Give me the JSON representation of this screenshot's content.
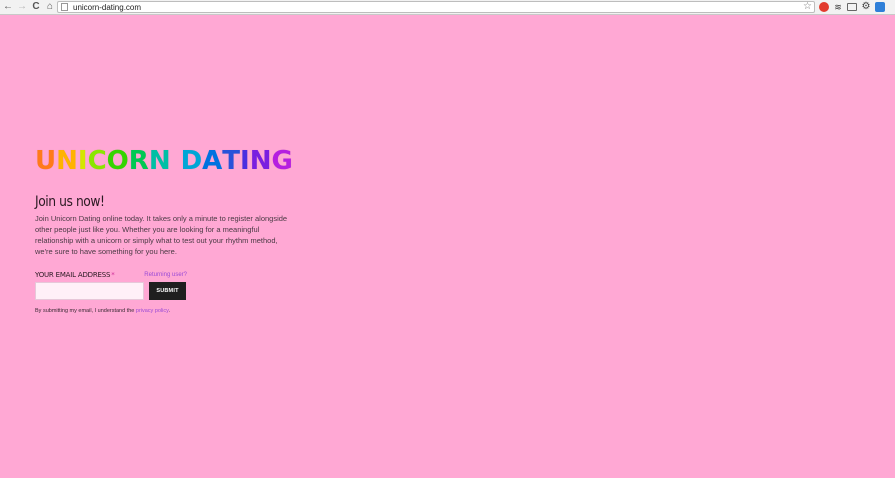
{
  "browser": {
    "url": "unicorn-dating.com",
    "back_glyph": "←",
    "forward_glyph": "→",
    "reload_glyph": "C",
    "home_glyph": "⌂",
    "star_glyph": "☆",
    "icons": [
      "back-arrow-icon",
      "forward-arrow-icon",
      "reload-icon",
      "home-icon",
      "page-icon",
      "star-icon",
      "opera-extension-icon",
      "stack-extension-icon",
      "cast-icon",
      "gear-extension-icon",
      "blue-extension-icon"
    ]
  },
  "page": {
    "logo_text": "UNICORN DATING",
    "logo_colors": [
      "#ff7a1a",
      "#ffb300",
      "#d4e600",
      "#8ae600",
      "#35d400",
      "#00c853",
      "#00bfa5",
      "#00a6d6",
      "#0072e0",
      "#2952d9",
      "#4a2fe0",
      "#7a1fe0",
      "#b51fe0",
      "#e01fc8"
    ],
    "heading": "Join us now!",
    "intro": "Join Unicorn Dating online today. It takes only a minute to register alongside other people just like you. Whether you are looking for a meaningful relationship with a unicorn or simply what to test out your rhythm method, we're sure to have something for you here.",
    "email_label": "YOUR EMAIL ADDRESS",
    "required_mark": "*",
    "returning_link": "Returning user?",
    "email_value": "",
    "submit_label": "SUBMIT",
    "policy_prefix": "By submitting my email, I understand the ",
    "policy_link": "privacy policy",
    "policy_suffix": "."
  },
  "colors": {
    "background": "#ffa8d4",
    "link": "#9b4bd6",
    "button": "#1f1f1f"
  }
}
